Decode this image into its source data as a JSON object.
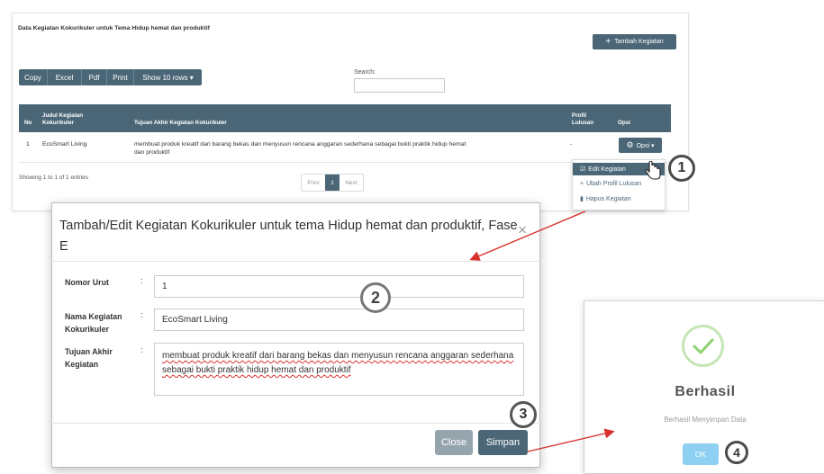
{
  "panel": {
    "title": "Data Kegiatan Kokurikuler untuk Tema Hidup hemat dan produktif",
    "add_button": "Tambah Kegiatan",
    "toolbar": [
      "Copy",
      "Excel",
      "Pdf",
      "Print",
      "Show 10 rows ▾"
    ],
    "search_label": "Search:",
    "search_value": ""
  },
  "table": {
    "headers": {
      "no": "No",
      "judul": [
        "Judul Kegiatan",
        "Kokurikuler"
      ],
      "tujuan": "Tujuan Akhir Kegiatan Kokurikuler",
      "profil": [
        "Profil",
        "Lulusan"
      ],
      "opsi": "Opsi"
    },
    "rows": [
      {
        "no": "1",
        "judul": "EcoSmart Living",
        "tujuan_line1": "membuat produk kreatif dari barang bekas dan menyusun rencana anggaran sederhana sebagai bukti praktik hidup hemat",
        "tujuan_line2": "dan produktif",
        "profil": "-",
        "opsi_button": "Opsi ▾"
      }
    ],
    "footer": "Showing 1 to 1 of 1 entries",
    "pager": {
      "prev": "Prev",
      "current": "1",
      "next": "Next"
    }
  },
  "dropdown": {
    "items": [
      "Edit Kegiatan",
      "Ubah Profil Lulusan",
      "Hapus Kegiatan"
    ]
  },
  "steps": [
    "1",
    "2",
    "3",
    "4"
  ],
  "modal": {
    "title": "Tambah/Edit Kegiatan Kokurikuler untuk tema Hidup hemat dan produktif, Fase E",
    "close_glyph": "×",
    "fields": {
      "nomor_label": "Nomor Urut",
      "nomor_value": "1",
      "nama_label": [
        "Nama Kegiatan",
        "Kokurikuler"
      ],
      "nama_value": "EcoSmart Living",
      "tujuan_label": [
        "Tujuan Akhir",
        "Kegiatan"
      ],
      "tujuan_value": "membuat produk kreatif dari barang bekas dan menyusun rencana anggaran sederhana sebagai bukti praktik hidup hemat dan produktif"
    },
    "colon": ":",
    "close_button": "Close",
    "save_button": "Simpan"
  },
  "success": {
    "title": "Berhasil",
    "message": "Berhasil Menyimpan Data",
    "ok_button": "OK"
  },
  "colors": {
    "accent": "#4b6777",
    "arrow": "#d9302c",
    "success_check": "#8fd16f",
    "ok_button": "#8ed0f2"
  }
}
